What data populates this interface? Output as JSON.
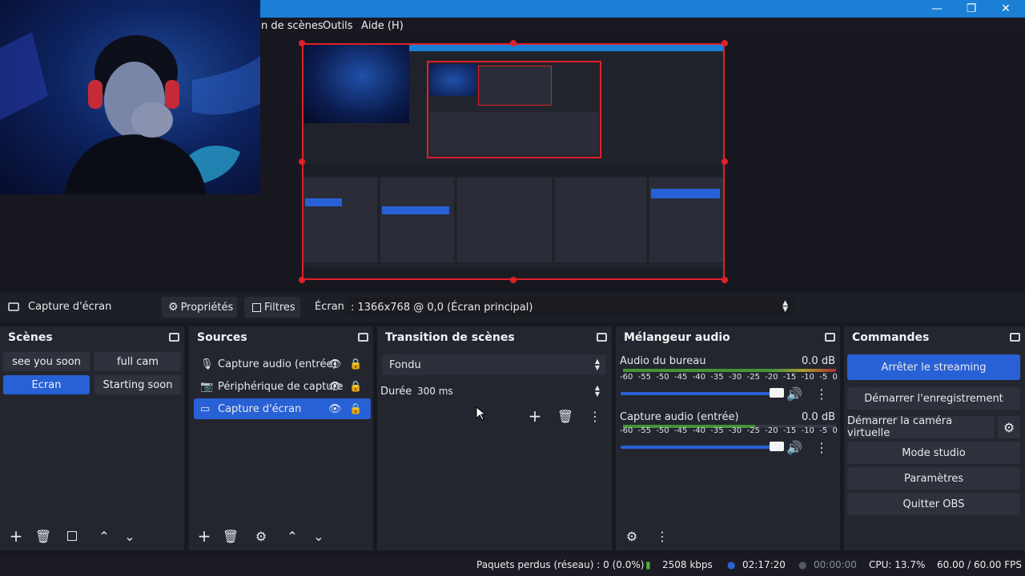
{
  "window": {
    "minimize": "—",
    "maximize": "❐",
    "close": "✕"
  },
  "menu": {
    "items": [
      "n de scènes",
      "Outils",
      "Aide (H)"
    ]
  },
  "source_bar": {
    "source_name": "Capture d'écran",
    "properties": "Propriétés",
    "filters": "Filtres",
    "screen_label": "Écran",
    "screen_value": ": 1366x768 @ 0,0 (Écran principal)"
  },
  "scenes": {
    "title": "Scènes",
    "items": [
      {
        "label": "see you soon",
        "active": false
      },
      {
        "label": "full cam",
        "active": false
      },
      {
        "label": "Ecran",
        "active": true
      },
      {
        "label": "Starting soon",
        "active": false
      }
    ]
  },
  "sources": {
    "title": "Sources",
    "items": [
      {
        "label": "Capture audio (entrée)",
        "icon": "microphone-icon",
        "active": false
      },
      {
        "label": "Périphérique de capture",
        "icon": "camera-icon",
        "active": false
      },
      {
        "label": "Capture d'écran",
        "icon": "monitor-icon",
        "active": true
      }
    ]
  },
  "transitions": {
    "title": "Transition de scènes",
    "selected": "Fondu",
    "duration_label": "Durée",
    "duration_value": "300 ms"
  },
  "mixer": {
    "title": "Mélangeur audio",
    "ticks": [
      "-60",
      "-55",
      "-50",
      "-45",
      "-40",
      "-35",
      "-30",
      "-25",
      "-20",
      "-15",
      "-10",
      "-5",
      "0"
    ],
    "channels": [
      {
        "name": "Audio du bureau",
        "level": "0.0 dB",
        "volume": 0.95
      },
      {
        "name": "Capture audio (entrée)",
        "level": "0.0 dB",
        "volume": 0.95
      }
    ]
  },
  "controls": {
    "title": "Commandes",
    "stop_stream": "Arrêter le streaming",
    "start_record": "Démarrer l'enregistrement",
    "virtual_cam": "Démarrer la caméra virtuelle",
    "studio_mode": "Mode studio",
    "settings": "Paramètres",
    "quit": "Quitter OBS"
  },
  "status": {
    "dropped": "Paquets perdus (réseau) : 0 (0.0%)",
    "bitrate": "2508 kbps",
    "stream_time": "02:17:20",
    "record_time": "00:00:00",
    "cpu": "CPU: 13.7%",
    "fps": "60.00 / 60.00 FPS"
  },
  "colors": {
    "accent": "#2861d6",
    "preview_border": "#e0202a",
    "titlebar": "#1b7fd6",
    "meter_green": "#4caf3a"
  }
}
